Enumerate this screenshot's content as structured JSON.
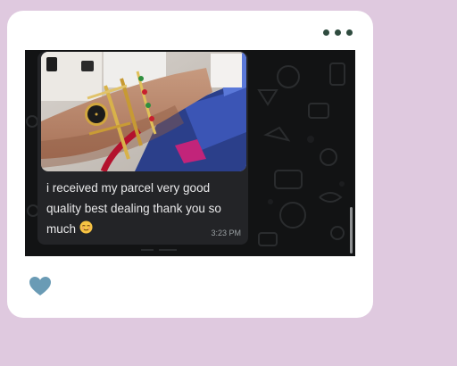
{
  "review": {
    "message": {
      "text": "i received my parcel very good quality best dealing thank you so much",
      "emoji": "relieved-face",
      "timestamp": "3:23 PM"
    },
    "menu_icon": "more-horizontal-icon",
    "like_icon": "heart-icon"
  },
  "colors": {
    "page_background": "#dfc9df",
    "card": "#ffffff",
    "chat_background": "#121314",
    "bubble": "#232427",
    "heart": "#6a9bb5",
    "menu_dots": "#2f4b3f"
  }
}
